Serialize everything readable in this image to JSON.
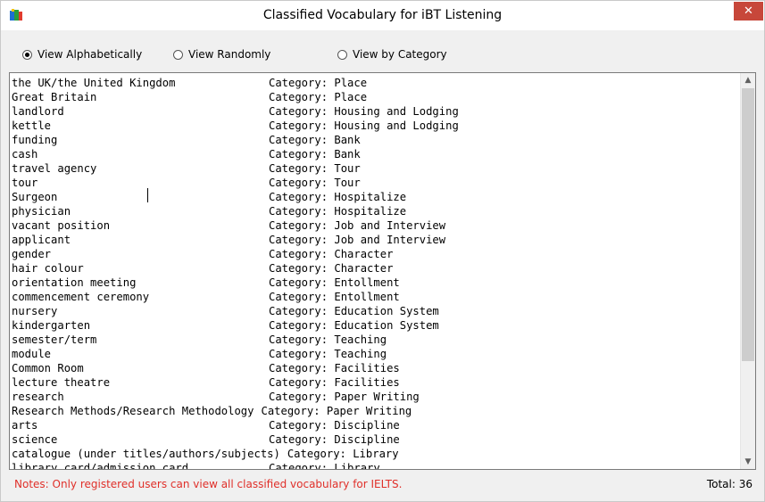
{
  "window": {
    "title": "Classified Vocabulary for iBT Listening",
    "icon": "app-book-icon",
    "close_label": "✕",
    "accent_color": "#c7473a"
  },
  "view_options": [
    {
      "label": "View Alphabetically",
      "selected": true
    },
    {
      "label": "View Randomly",
      "selected": false
    },
    {
      "label": "View by Category",
      "selected": false
    }
  ],
  "vocabulary": {
    "rows": [
      {
        "term": "the UK/the United Kingdom",
        "category": "Category: Place"
      },
      {
        "term": "Great Britain",
        "category": "Category: Place"
      },
      {
        "term": "landlord",
        "category": "Category: Housing and Lodging"
      },
      {
        "term": "kettle",
        "category": "Category: Housing and Lodging"
      },
      {
        "term": "funding",
        "category": "Category: Bank"
      },
      {
        "term": "cash",
        "category": "Category: Bank"
      },
      {
        "term": "travel agency",
        "category": "Category: Tour"
      },
      {
        "term": "tour",
        "category": "Category: Tour"
      },
      {
        "term": "Surgeon",
        "category": "Category: Hospitalize"
      },
      {
        "term": "physician",
        "category": "Category: Hospitalize"
      },
      {
        "term": "vacant position",
        "category": "Category: Job and Interview"
      },
      {
        "term": "applicant",
        "category": "Category: Job and Interview"
      },
      {
        "term": "gender",
        "category": "Category: Character"
      },
      {
        "term": "hair colour",
        "category": "Category: Character"
      },
      {
        "term": "orientation meeting",
        "category": "Category: Entollment"
      },
      {
        "term": "commencement ceremony",
        "category": "Category: Entollment"
      },
      {
        "term": "nursery",
        "category": "Category: Education System"
      },
      {
        "term": "kindergarten",
        "category": "Category: Education System"
      },
      {
        "term": "semester/term",
        "category": "Category: Teaching"
      },
      {
        "term": "module",
        "category": "Category: Teaching"
      },
      {
        "term": "Common Room",
        "category": "Category: Facilities"
      },
      {
        "term": "lecture theatre",
        "category": "Category: Facilities"
      },
      {
        "term": "research",
        "category": "Category: Paper Writing"
      },
      {
        "term": "Research Methods/Research Methodology",
        "category": "Category: Paper Writing"
      },
      {
        "term": "arts",
        "category": "Category: Discipline"
      },
      {
        "term": "science",
        "category": "Category: Discipline"
      },
      {
        "term": "catalogue (under titles/authors/subjects)",
        "category": "Category: Library"
      },
      {
        "term": "library card/admission card",
        "category": "Category: Library"
      }
    ]
  },
  "status": {
    "notes": "Notes: Only registered users can view all classified vocabulary for IELTS.",
    "notes_color": "#e0302a",
    "total_label": "Total: 36"
  },
  "scrollbar": {
    "up_icon": "scroll-up-arrow-icon",
    "down_icon": "scroll-down-arrow-icon"
  }
}
